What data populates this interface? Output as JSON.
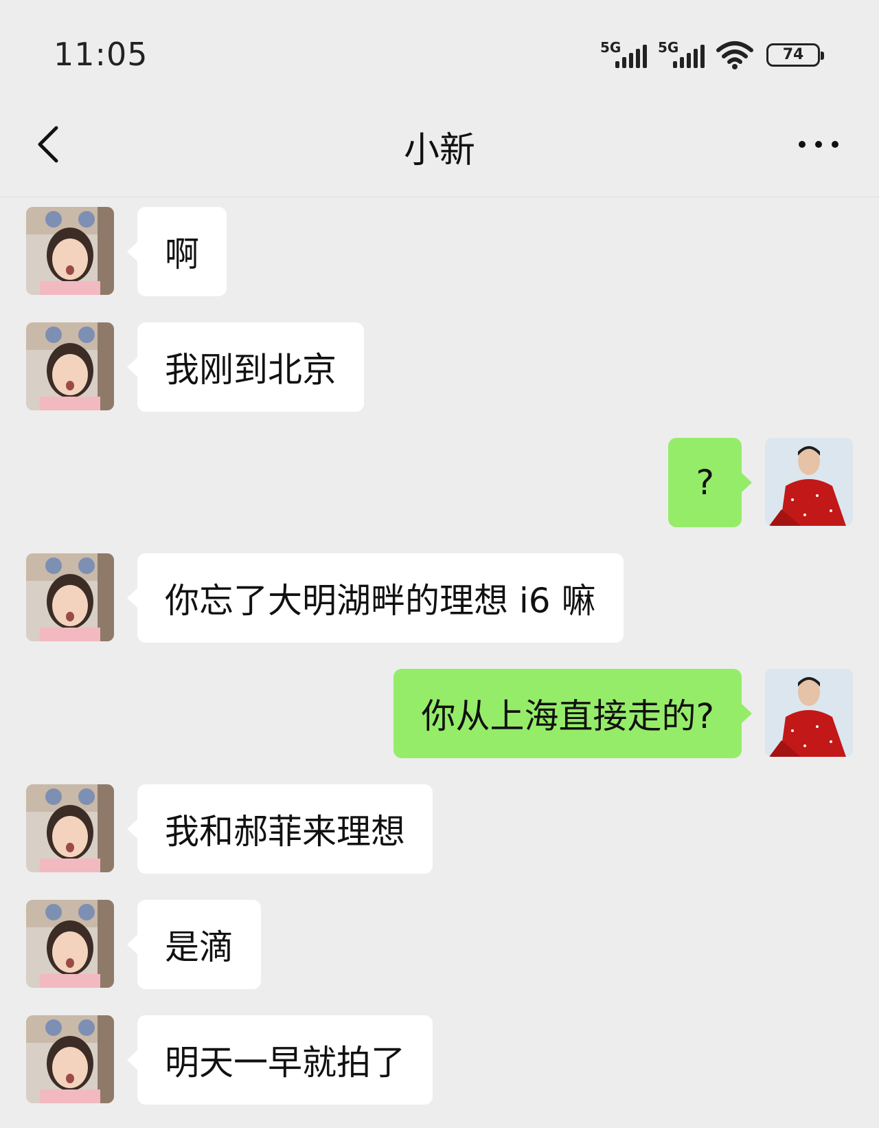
{
  "status_bar": {
    "time": "11:05",
    "signal_1_label": "5G",
    "signal_2_label": "5G",
    "battery_level": "74",
    "icons": [
      "signal-icon",
      "signal-icon",
      "wifi-icon",
      "battery-icon"
    ]
  },
  "nav": {
    "title": "小新",
    "back_icon": "chevron-left-icon",
    "more_icon": "more-icon"
  },
  "colors": {
    "background": "#ededed",
    "received_bubble": "#ffffff",
    "sent_bubble": "#95ec69"
  },
  "messages": [
    {
      "side": "received",
      "text": "啊"
    },
    {
      "side": "received",
      "text": "我刚到北京"
    },
    {
      "side": "sent",
      "text": "?"
    },
    {
      "side": "received",
      "text": "你忘了大明湖畔的理想 i6 嘛"
    },
    {
      "side": "sent",
      "text": "你从上海直接走的?"
    },
    {
      "side": "received",
      "text": "我和郝菲来理想"
    },
    {
      "side": "received",
      "text": "是滴"
    },
    {
      "side": "received",
      "text": "明天一早就拍了"
    }
  ]
}
